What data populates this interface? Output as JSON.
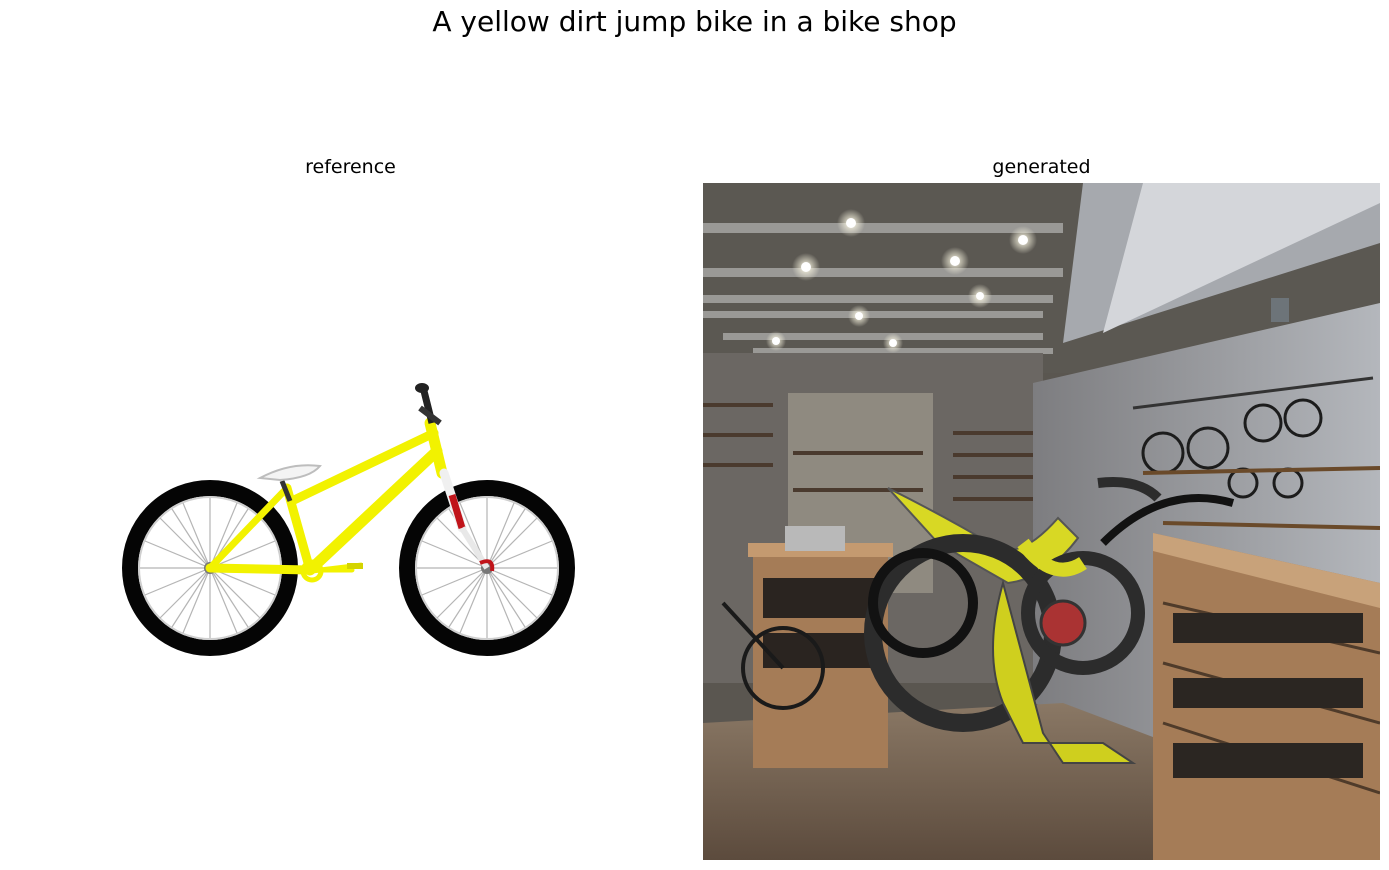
{
  "figure": {
    "title": "A yellow dirt jump bike in a bike shop"
  },
  "panels": [
    {
      "title": "reference"
    },
    {
      "title": "generated"
    }
  ],
  "colors": {
    "bike_yellow": "#f2f200",
    "tire_black": "#050505",
    "fork_red": "#c0141a",
    "shop_wall": "#8f8f8f",
    "shop_wood": "#a57c57",
    "shop_floor": "#6b5a4a"
  }
}
